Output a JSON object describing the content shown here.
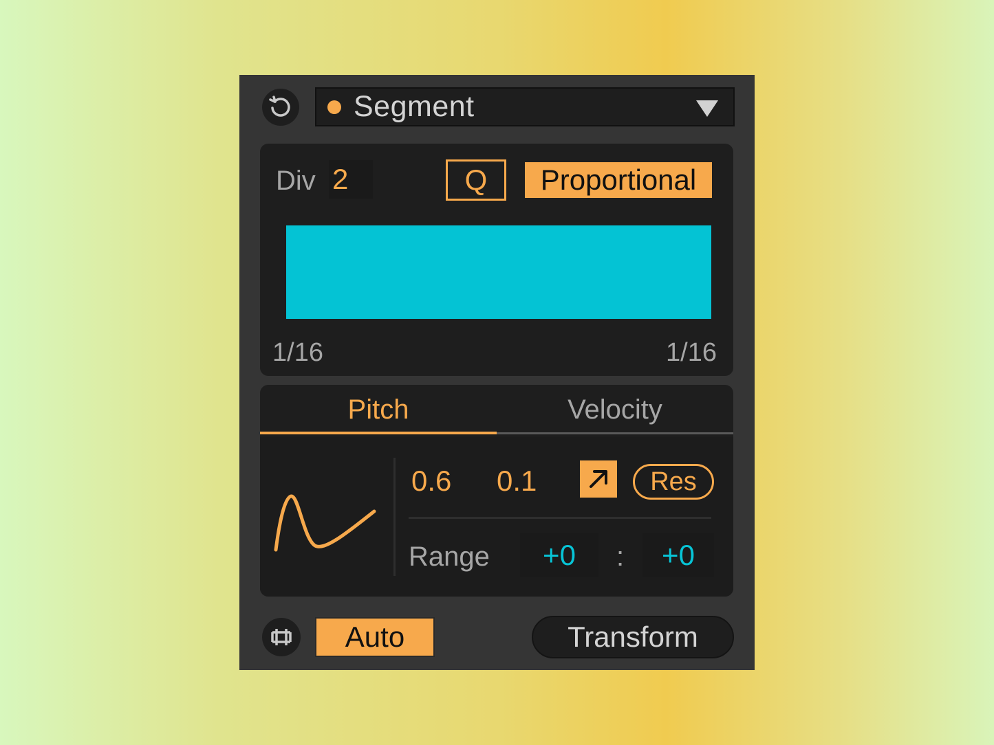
{
  "header": {
    "preset_label": "Segment"
  },
  "division": {
    "label": "Div",
    "value": "2",
    "q_label": "Q",
    "mode_label": "Proportional",
    "left_note": "1/16",
    "right_note": "1/16"
  },
  "tabs": [
    {
      "label": "Pitch",
      "active": true
    },
    {
      "label": "Velocity",
      "active": false
    }
  ],
  "pitch": {
    "value_a": "0.6",
    "value_b": "0.1",
    "res_label": "Res",
    "range_label": "Range",
    "range_low": "+0",
    "range_sep": ":",
    "range_high": "+0"
  },
  "footer": {
    "auto_label": "Auto",
    "transform_label": "Transform"
  },
  "colors": {
    "accent": "#f7a94c",
    "cyan": "#04c3d4",
    "panel": "#1e1e1e",
    "device_bg": "#353535"
  },
  "icons": [
    "reset-icon",
    "dropdown-arrow-icon",
    "curve-icon",
    "arrow-up-right-icon",
    "link-icon"
  ]
}
